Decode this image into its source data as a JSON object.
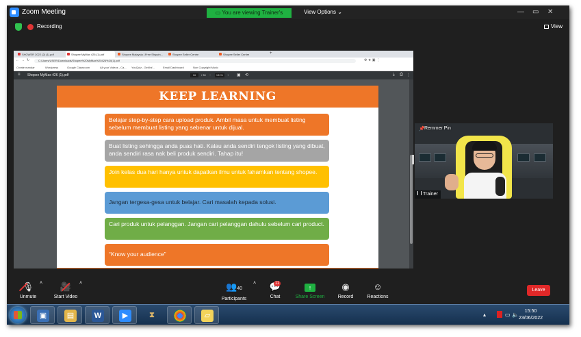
{
  "zoom": {
    "window_title": "Zoom Meeting",
    "viewing_banner": "You are viewing Trainer's screen",
    "view_options": "View Options",
    "recording_label": "Recording",
    "view_button": "View"
  },
  "browser": {
    "tabs": [
      "SHOWER 2022 (2) (1).pdf",
      "Shopee MyMax 426 (1).pdf",
      "Shopee Malaysia | Free Shippin...",
      "Shopee Seller Centre",
      "Shopee Seller Centre"
    ],
    "url": "C:/Users/USER/Downloads/Shopee%20MyMax%20426%20(1).pdf",
    "bookmarks": [
      "Create mandar",
      "Wordpress",
      "Google Classroom",
      "All your Videos - Ca...",
      "YouQuiz - Get/Inf...",
      "Email Dashboard",
      "Non Copyright Music"
    ],
    "pdf_title": "Shopee MyMax 426 (1).pdf",
    "page_current": "16",
    "page_total": "/ 30",
    "zoom_value": "131%"
  },
  "slide": {
    "title": "KEEP LEARNING",
    "cards": [
      "Belajar step-by-step cara upload produk. Ambil masa untuk membuat listing sebelum membuat listing yang sebenar untuk dijual.",
      "Buat listing sehingga anda puas hati. Kalau anda sendiri tengok listing yang dibuat, anda sendiri rasa nak beli produk sendiri. Tahap itu!",
      "Join kelas dua hari hanya untuk dapatkan ilmu untuk fahamkan tentang shopee.",
      "Jangan tergesa-gesa untuk belajar. Cari masalah kepada solusi.",
      "Cari produk untuk pelanggan. Jangan cari pelanggan dahulu sebelum cari product.",
      "“Know your audience”"
    ],
    "colors": {
      "orange": "#ee7628",
      "gray": "#a5a5a5",
      "gold": "#ffc000",
      "blue": "#5b9bd5",
      "green": "#70ad47"
    }
  },
  "video": {
    "pin_label": "Remmer Pin",
    "name": "Trainer"
  },
  "toolbar": {
    "unmute": "Unmute",
    "start_video": "Start Video",
    "participants": "Participants",
    "participants_count": "40",
    "chat": "Chat",
    "chat_badge": "11",
    "share_screen": "Share Screen",
    "record": "Record",
    "reactions": "Reactions",
    "leave": "Leave"
  },
  "taskbar": {
    "time": "15:50",
    "date": "23/06/2022",
    "word_letter": "W"
  }
}
